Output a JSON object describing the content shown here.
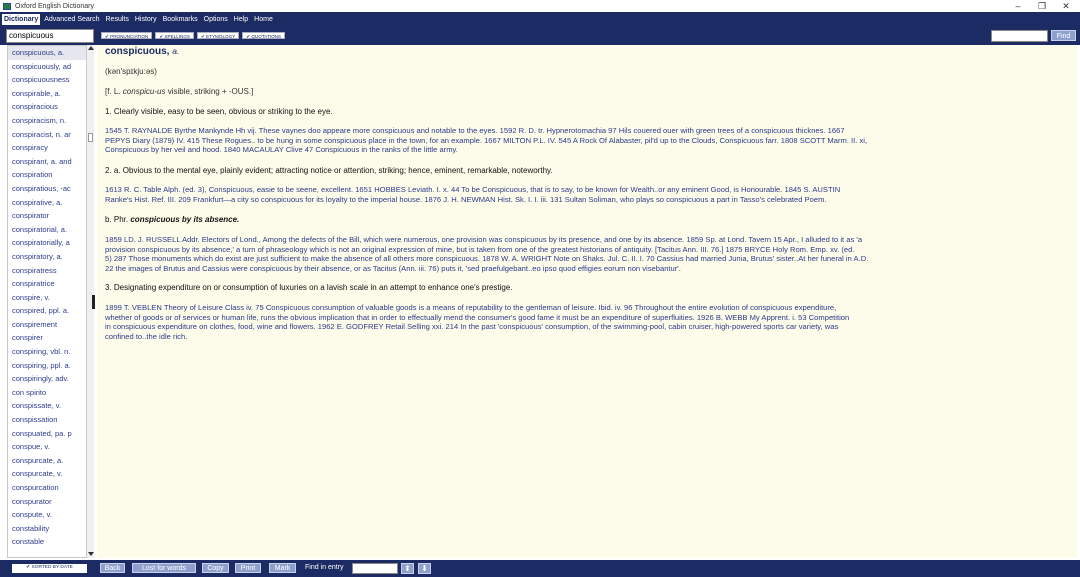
{
  "window": {
    "title": "Oxford English Dictionary",
    "controls": {
      "minimize": "–",
      "maximize": "❐",
      "close": "✕"
    }
  },
  "menu": {
    "items": [
      "Dictionary",
      "Advanced Search",
      "Results",
      "History",
      "Bookmarks",
      "Options",
      "Help",
      "Home"
    ],
    "active": "Dictionary"
  },
  "toolbar": {
    "search_value": "conspicuous",
    "filters": [
      "✔ PRONUNCIATION",
      "✔ SPELLINGS",
      "✔ ETYMOLOGY",
      "✔ QUOTATIONS"
    ],
    "find_value": "",
    "find_label": "Find"
  },
  "sidebar": {
    "items": [
      "conspicuous, a.",
      "conspicuously, ad",
      "conspicuousness",
      "conspirable, a.",
      "conspiracious",
      "conspiracism, n.",
      "conspiracist, n. ar",
      "conspiracy",
      "conspirant, a. and",
      "conspiration",
      "conspiratious, -ac",
      "conspirative, a.",
      "conspirator",
      "conspiratorial, a.",
      "conspiratorially, a",
      "conspiratory, a.",
      "conspiratress",
      "conspiratrice",
      "conspire, v.",
      "conspired, ppl. a.",
      "conspirement",
      "conspirer",
      "conspiring, vbl. n.",
      "conspiring, ppl. a.",
      "conspiringly, adv.",
      "con spirito",
      "conspissate, v.",
      "conspissation",
      "conspuated, pa. p",
      "conspue, v.",
      "conspurcate, a.",
      "conspurcate, v.",
      "conspurcation",
      "conspurator",
      "conspute, v.",
      "constability",
      "constable"
    ]
  },
  "entry": {
    "headword": "conspicuous,",
    "pos": "a.",
    "pronunciation": "(kən'spɪkju:əs)",
    "etymology_pre": "[f. L. ",
    "etymology_word": "conspicu-us",
    "etymology_post": " visible, striking + -OUS.]",
    "sense1": "1. Clearly visible, easy to be seen, obvious or striking to the eye.",
    "quotes1_a": "1545 T. RAYNALDE Byrthe Mankynde Hh vij. These vaynes doo appeare more conspicuous and notable to the eyes.   1592 R. D. tr. Hypnerotomachia 97 Hils couered ouer with green trees of a conspicuous thicknes.   1667",
    "quotes1_b": "PEPYS Diary (1879) IV. 415 These Rogues.. to be hung in some conspicuous place in the town, for an example.   1667 MILTON P.L. IV. 545 A Rock Of Alabaster, pil'd up to the Clouds, Conspicuous farr.   1808 SCOTT Marm. II. xi,",
    "quotes1_c": "Conspicuous by her veil and hood.   1840 MACAULAY Clive 47 Conspicuous in the ranks of the little army.",
    "sense2a": "2. a. Obvious to the mental eye, plainly evident; attracting notice or attention, striking; hence, eminent, remarkable, noteworthy.",
    "quotes2a_a": "1613 R. C. Table Alph. (ed. 3), Conspicuous, easie to be seene, excellent.   1651 HOBBES Leviath. I. x. 44 To be Conspicuous, that is to say, to be known for Wealth..or any eminent Good, is Honourable.   1845 S. AUSTIN",
    "quotes2a_b": "Ranke's Hist. Ref. III. 209 Frankfurt—a city so conspicuous for its loyalty to the imperial house.   1876 J. H. NEWMAN Hist. Sk. I. I. iii. 131 Sultan Soliman, who plays so conspicuous a part in Tasso's celebrated Poem.",
    "sense2b_pre": "b. Phr. ",
    "sense2b_phrase": "conspicuous by its absence.",
    "quotes2b_a": "1859 LD. J. RUSSELL Addr. Electors of Lond., Among the defects of the Bill, which were numerous, one provision was conspicuous by its presence, and one by its absence.   1859 Sp. at Lond. Tavern 15 Apr., I alluded to it as 'a",
    "quotes2b_b": "provision conspicuous by its absence,' a turn of phraseology which is not an original expression of mine, but is taken from one of the greatest historians of antiquity. [Tacitus Ann. III. 76.]   1875 BRYCE Holy Rom. Emp. xv. (ed.",
    "quotes2b_c": "5) 287 Those monuments which do exist are just sufficient to make the absence of all others more conspicuous.   1878 W. A. WRIGHT Note on Shaks. Jul. C. II. I. 70 Cassius had married Junia, Brutus' sister..At her funeral in A.D.",
    "quotes2b_d": "22 the images of Brutus and Cassius were conspicuous by their absence, or as Tacitus (Ann. iii. 76) puts it, 'sed praefulgebant..eo ipso quod effigies eorum non visebantur'.",
    "sense3": "3. Designating expenditure on or consumption of luxuries on a lavish scale in an attempt to enhance one's prestige.",
    "quotes3_a": "1899 T. VEBLEN Theory of Leisure Class iv. 75 Conspicuous consumption of valuable goods is a means of reputability to the gentleman of leisure.   Ibid. iv. 96 Throughout the entire evolution of conspicuous expenditure,",
    "quotes3_b": "whether of goods or of services or human life, runs the obvious implication that in order to effectually mend the consumer's good fame it must be an expenditure of superfluities.   1926 B. WEBB My Apprent. i. 53 Competition",
    "quotes3_c": "in conspicuous expenditure on clothes, food, wine and flowers.   1962 E. GODFREY Retail Selling xxi. 214 In the past 'conspicuous' consumption, of the swimming-pool, cabin cruiser, high-powered sports car variety, was",
    "quotes3_d": "confined to..the idle rich."
  },
  "bottom": {
    "sort_label": "✔ SORTED BY DATE",
    "back_label": "Back",
    "lost_label": "Lost for words",
    "copy_label": "Copy",
    "print_label": "Print",
    "mark_label": "Mark",
    "find_in_entry_label": "Find in entry",
    "find_in_entry_value": "",
    "up_arrow": "⬆",
    "down_arrow": "⬇"
  },
  "colors": {
    "navy": "#1c2b63",
    "link": "#2d3b8c",
    "entry_bg": "#fdfbe9"
  }
}
